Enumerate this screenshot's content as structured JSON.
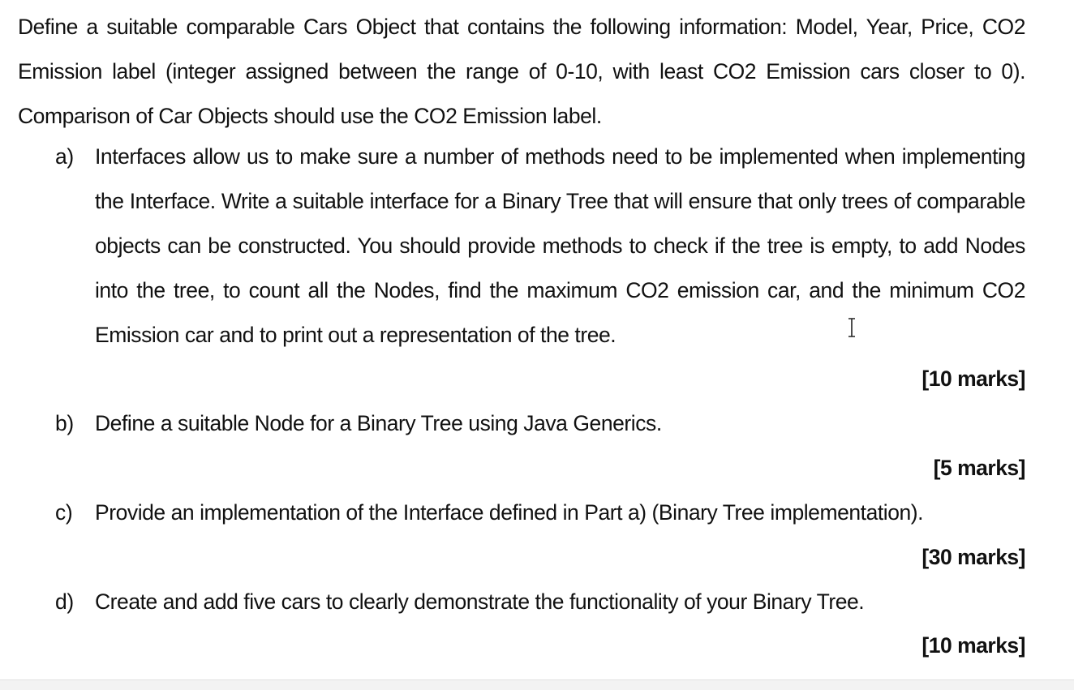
{
  "intro": {
    "text": "Define a suitable comparable Cars Object that contains the following information: Model, Year, Price, CO2 Emission label (integer assigned between the range of 0-10, with least CO2 Emission cars closer to 0). Comparison of Car Objects should use the CO2 Emission label."
  },
  "questions": [
    {
      "label": "a)",
      "text": "Interfaces allow us to make sure a number of methods need to be implemented when implementing the Interface. Write a suitable interface for a Binary Tree that will ensure that only trees of comparable objects can be constructed. You should provide methods to check if the tree is empty, to add Nodes into the tree, to count all the Nodes, find the maximum CO2 emission car, and the minimum CO2 Emission car and to print out a representation of the tree.",
      "marks": "[10 marks]"
    },
    {
      "label": "b)",
      "text": "Define a suitable Node for a Binary Tree using Java Generics.",
      "marks": "[5 marks]"
    },
    {
      "label": "c)",
      "text": "Provide an implementation of the Interface defined in Part a) (Binary Tree implementation).",
      "marks": "[30 marks]"
    },
    {
      "label": "d)",
      "text": "Create and add five cars to clearly demonstrate the functionality of your Binary Tree.",
      "marks": "[10 marks]"
    }
  ],
  "cursor_icon": "text-ibeam-cursor-icon"
}
